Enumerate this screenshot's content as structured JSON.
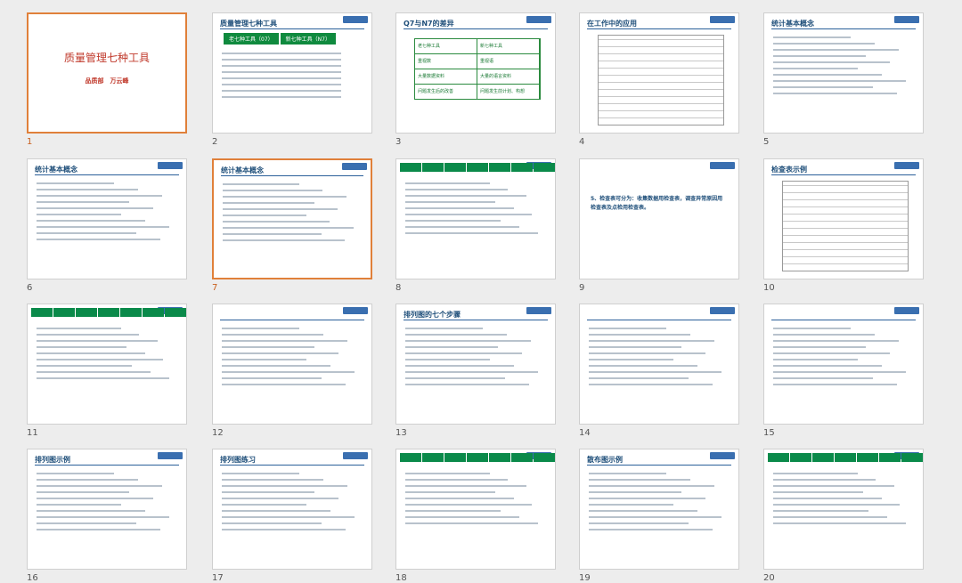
{
  "slides": [
    {
      "num": "1",
      "kind": "cover",
      "title": "质量管理七种工具",
      "sub": "品质部　万云峰"
    },
    {
      "num": "2",
      "kind": "tabs",
      "title": "质量管理七种工具",
      "tabs": [
        "老七种工具（07）",
        "新七种工具（N7）"
      ]
    },
    {
      "num": "3",
      "kind": "table",
      "title": "Q7与N7的差异",
      "rows": [
        [
          "老七种工具",
          "新七种工具"
        ],
        [
          "重视数",
          "重视语"
        ],
        [
          "大量数据资料",
          "大量的语言资料"
        ],
        [
          "问题发生后的改善",
          "问题发生前计划、构想"
        ]
      ]
    },
    {
      "num": "4",
      "kind": "grid",
      "title": "在工作中的应用"
    },
    {
      "num": "5",
      "kind": "text",
      "title": "统计基本概念"
    },
    {
      "num": "6",
      "kind": "text",
      "title": "统计基本概念"
    },
    {
      "num": "7",
      "kind": "text",
      "title": "统计基本概念"
    },
    {
      "num": "8",
      "kind": "green"
    },
    {
      "num": "9",
      "kind": "big",
      "text": "5、检查表可分为：收集数据用检查表，调查异常原因用检查表及点检用检查表。"
    },
    {
      "num": "10",
      "kind": "grid",
      "title": "检查表示例"
    },
    {
      "num": "11",
      "kind": "green"
    },
    {
      "num": "12",
      "kind": "text",
      "title": ""
    },
    {
      "num": "13",
      "kind": "text",
      "title": "排列图的七个步骤"
    },
    {
      "num": "14",
      "kind": "text",
      "title": ""
    },
    {
      "num": "15",
      "kind": "text",
      "title": ""
    },
    {
      "num": "16",
      "kind": "text",
      "title": "排列图示例"
    },
    {
      "num": "17",
      "kind": "text",
      "title": "排列图练习"
    },
    {
      "num": "18",
      "kind": "green"
    },
    {
      "num": "19",
      "kind": "text",
      "title": "散布图示例"
    },
    {
      "num": "20",
      "kind": "green"
    }
  ]
}
